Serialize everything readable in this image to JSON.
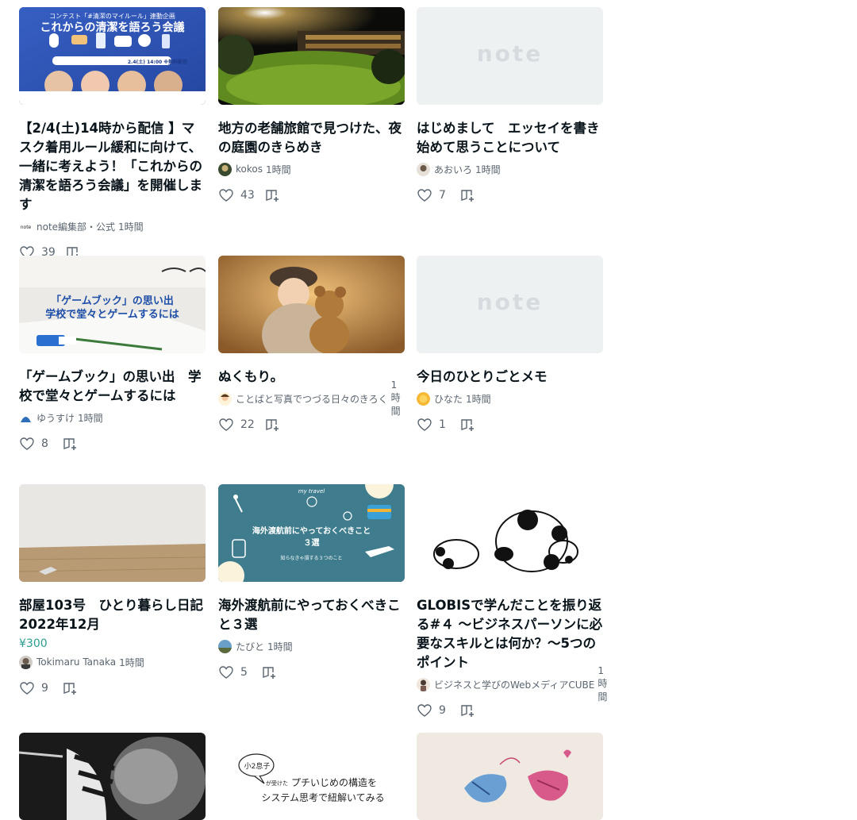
{
  "cards": [
    {
      "title": "【2/4(土)14時から配信 】マスク着用ルール緩和に向けて、一緒に考えよう！「これからの清潔を語ろう会議」を開催します",
      "author": "note編集部・公式",
      "time": "1時間",
      "likes": "39",
      "price": "",
      "thumb_text_top": "コンテスト「#清潔のマイルール」連動企画",
      "thumb_text_main": "これからの清潔を語ろう会議",
      "thumb_date": "2.4(土) 14:00 ※無料配信"
    },
    {
      "title": "地方の老舗旅館で見つけた、夜の庭園のきらめき",
      "author": "kokos",
      "time": "1時間",
      "likes": "43",
      "price": ""
    },
    {
      "title": "はじめまして　エッセイを書き始めて思うことについて",
      "author": "あおいろ",
      "time": "1時間",
      "likes": "7",
      "price": "",
      "placeholder": "note"
    },
    {
      "title": "「ゲームブック」の思い出　学校で堂々とゲームするには",
      "author": "ゆうすけ",
      "time": "1時間",
      "likes": "8",
      "price": "",
      "thumb_text_1": "「ゲームブック」の思い出",
      "thumb_text_2": "学校で堂々とゲームするには"
    },
    {
      "title": "ぬくもり。",
      "author": "ことばと写真でつづる日々のきろく",
      "time": "1時間",
      "likes": "22",
      "price": ""
    },
    {
      "title": "今日のひとりごとメモ",
      "author": "ひなた",
      "time": "1時間",
      "likes": "1",
      "price": "",
      "placeholder": "note"
    },
    {
      "title": "部屋103号　ひとり暮らし日記 2022年12月",
      "author": "Tokimaru Tanaka",
      "time": "1時間",
      "likes": "9",
      "price": "¥300"
    },
    {
      "title": "海外渡航前にやっておくべきこと３選",
      "author": "たびと",
      "time": "1時間",
      "likes": "5",
      "price": "",
      "thumb_text_1": "海外渡航前にやっておくべきこと",
      "thumb_text_2": "３選",
      "thumb_text_3": "知らなきゃ損する３つのこと",
      "thumb_text_4": "my travel"
    },
    {
      "title": "GLOBISで学んだことを振り返る#４ 〜ビジネスパーソンに必要なスキルとは何か？〜5つのポイント",
      "author": "ビジネスと学びのWebメディアCUBE",
      "time": "1時間",
      "likes": "9",
      "price": ""
    },
    {
      "title": "",
      "author": "",
      "time": "",
      "likes": "",
      "price": ""
    },
    {
      "title": "",
      "author": "",
      "time": "",
      "likes": "",
      "price": "",
      "thumb_text_1": "小2息子",
      "thumb_text_2": "が受けた",
      "thumb_text_3": "プチいじめの構造を",
      "thumb_text_4": "システム思考で紐解いてみる"
    },
    {
      "title": "",
      "author": "",
      "time": "",
      "likes": "",
      "price": ""
    }
  ],
  "colors": {
    "accent": "#2a9d8f",
    "text": "#08131a",
    "sub": "#5a6570",
    "placeholder_bg": "#eef1f2"
  }
}
